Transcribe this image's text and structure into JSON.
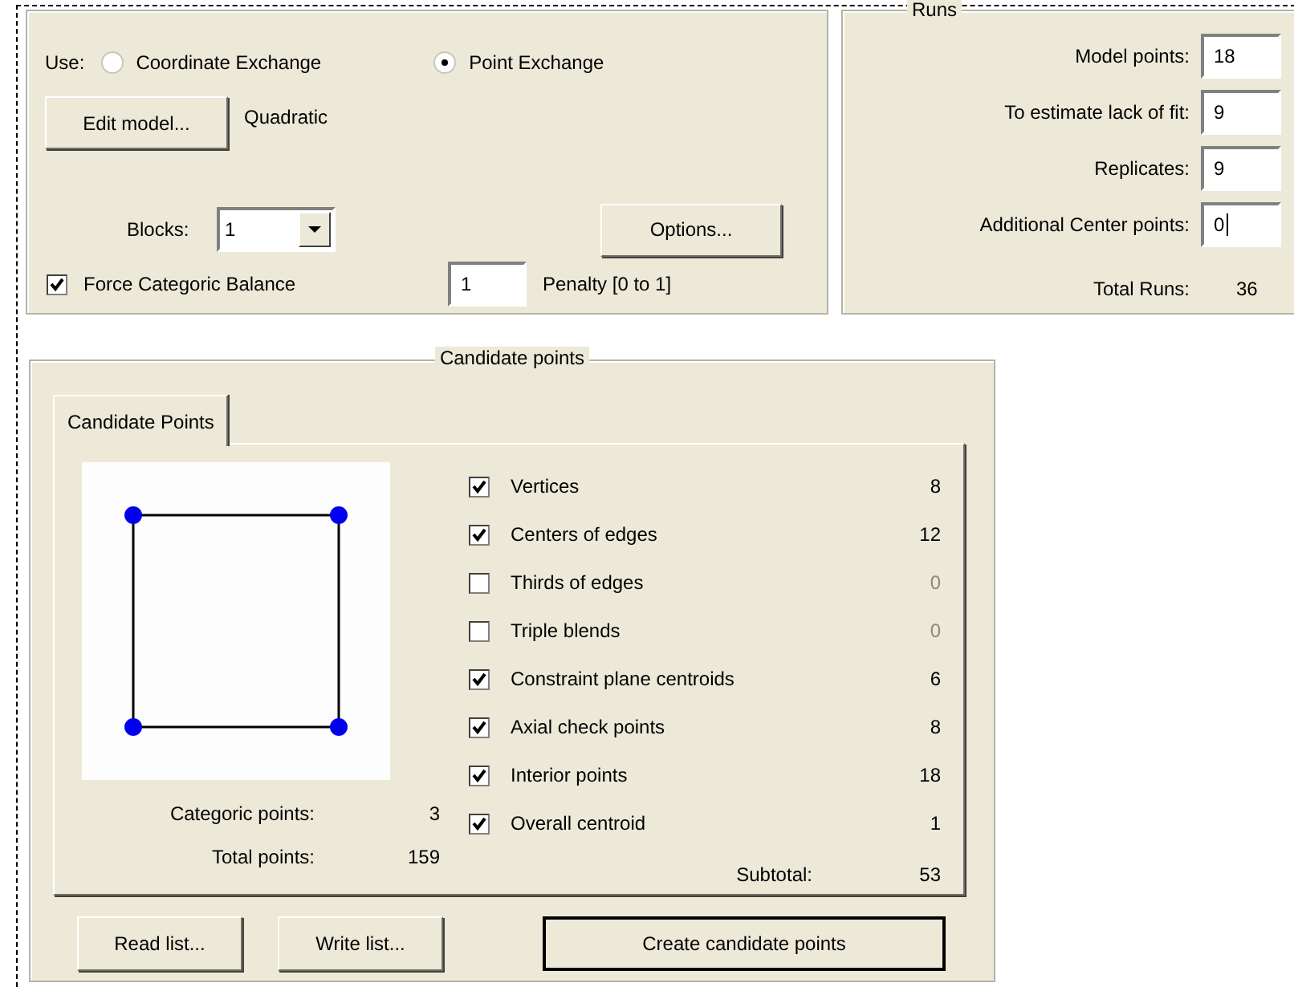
{
  "method": {
    "label": "Use:",
    "options": [
      {
        "label": "Coordinate Exchange",
        "selected": false
      },
      {
        "label": "Point Exchange",
        "selected": true
      }
    ]
  },
  "model": {
    "button": "Edit model...",
    "value": "Quadratic"
  },
  "blocks": {
    "label": "Blocks:",
    "value": "1"
  },
  "options_button": "Options...",
  "force_balance": {
    "label": "Force Categoric Balance",
    "checked": true
  },
  "penalty": {
    "value": "1",
    "label": "Penalty [0 to 1]"
  },
  "runs": {
    "title": "Runs",
    "fields": [
      {
        "label": "Model points:",
        "value": "18"
      },
      {
        "label": "To estimate lack of fit:",
        "value": "9"
      },
      {
        "label": "Replicates:",
        "value": "9"
      },
      {
        "label": "Additional Center points:",
        "value": "0"
      }
    ],
    "total_label": "Total Runs:",
    "total": "36"
  },
  "candidates": {
    "title": "Candidate points",
    "tabs": [
      {
        "label": "Candidate Points",
        "selected": true
      }
    ],
    "items": [
      {
        "label": "Vertices",
        "checked": true,
        "count": "8"
      },
      {
        "label": "Centers of edges",
        "checked": true,
        "count": "12"
      },
      {
        "label": "Thirds of edges",
        "checked": false,
        "count": "0"
      },
      {
        "label": "Triple blends",
        "checked": false,
        "count": "0"
      },
      {
        "label": "Constraint plane centroids",
        "checked": true,
        "count": "6"
      },
      {
        "label": "Axial check points",
        "checked": true,
        "count": "8"
      },
      {
        "label": "Interior points",
        "checked": true,
        "count": "18"
      },
      {
        "label": "Overall centroid",
        "checked": true,
        "count": "1"
      }
    ],
    "categoric_label": "Categoric points:",
    "categoric": "3",
    "total_label": "Total points:",
    "total": "159",
    "subtotal_label": "Subtotal:",
    "subtotal": "53"
  },
  "buttons": [
    {
      "label": "Read list...",
      "kind": "normal"
    },
    {
      "label": "Write list...",
      "kind": "normal"
    },
    {
      "label": "Create candidate points",
      "kind": "default"
    }
  ]
}
